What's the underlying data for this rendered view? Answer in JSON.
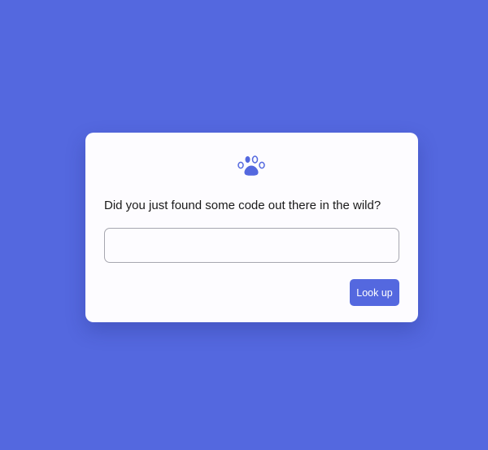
{
  "colors": {
    "background": "#5468df",
    "card": "#fdfcff",
    "accent": "#5468df"
  },
  "logo": {
    "icon": "paw-icon"
  },
  "form": {
    "question": "Did you just found some code out there in the wild?",
    "input_value": "",
    "input_placeholder": "",
    "button_label": "Look up"
  }
}
